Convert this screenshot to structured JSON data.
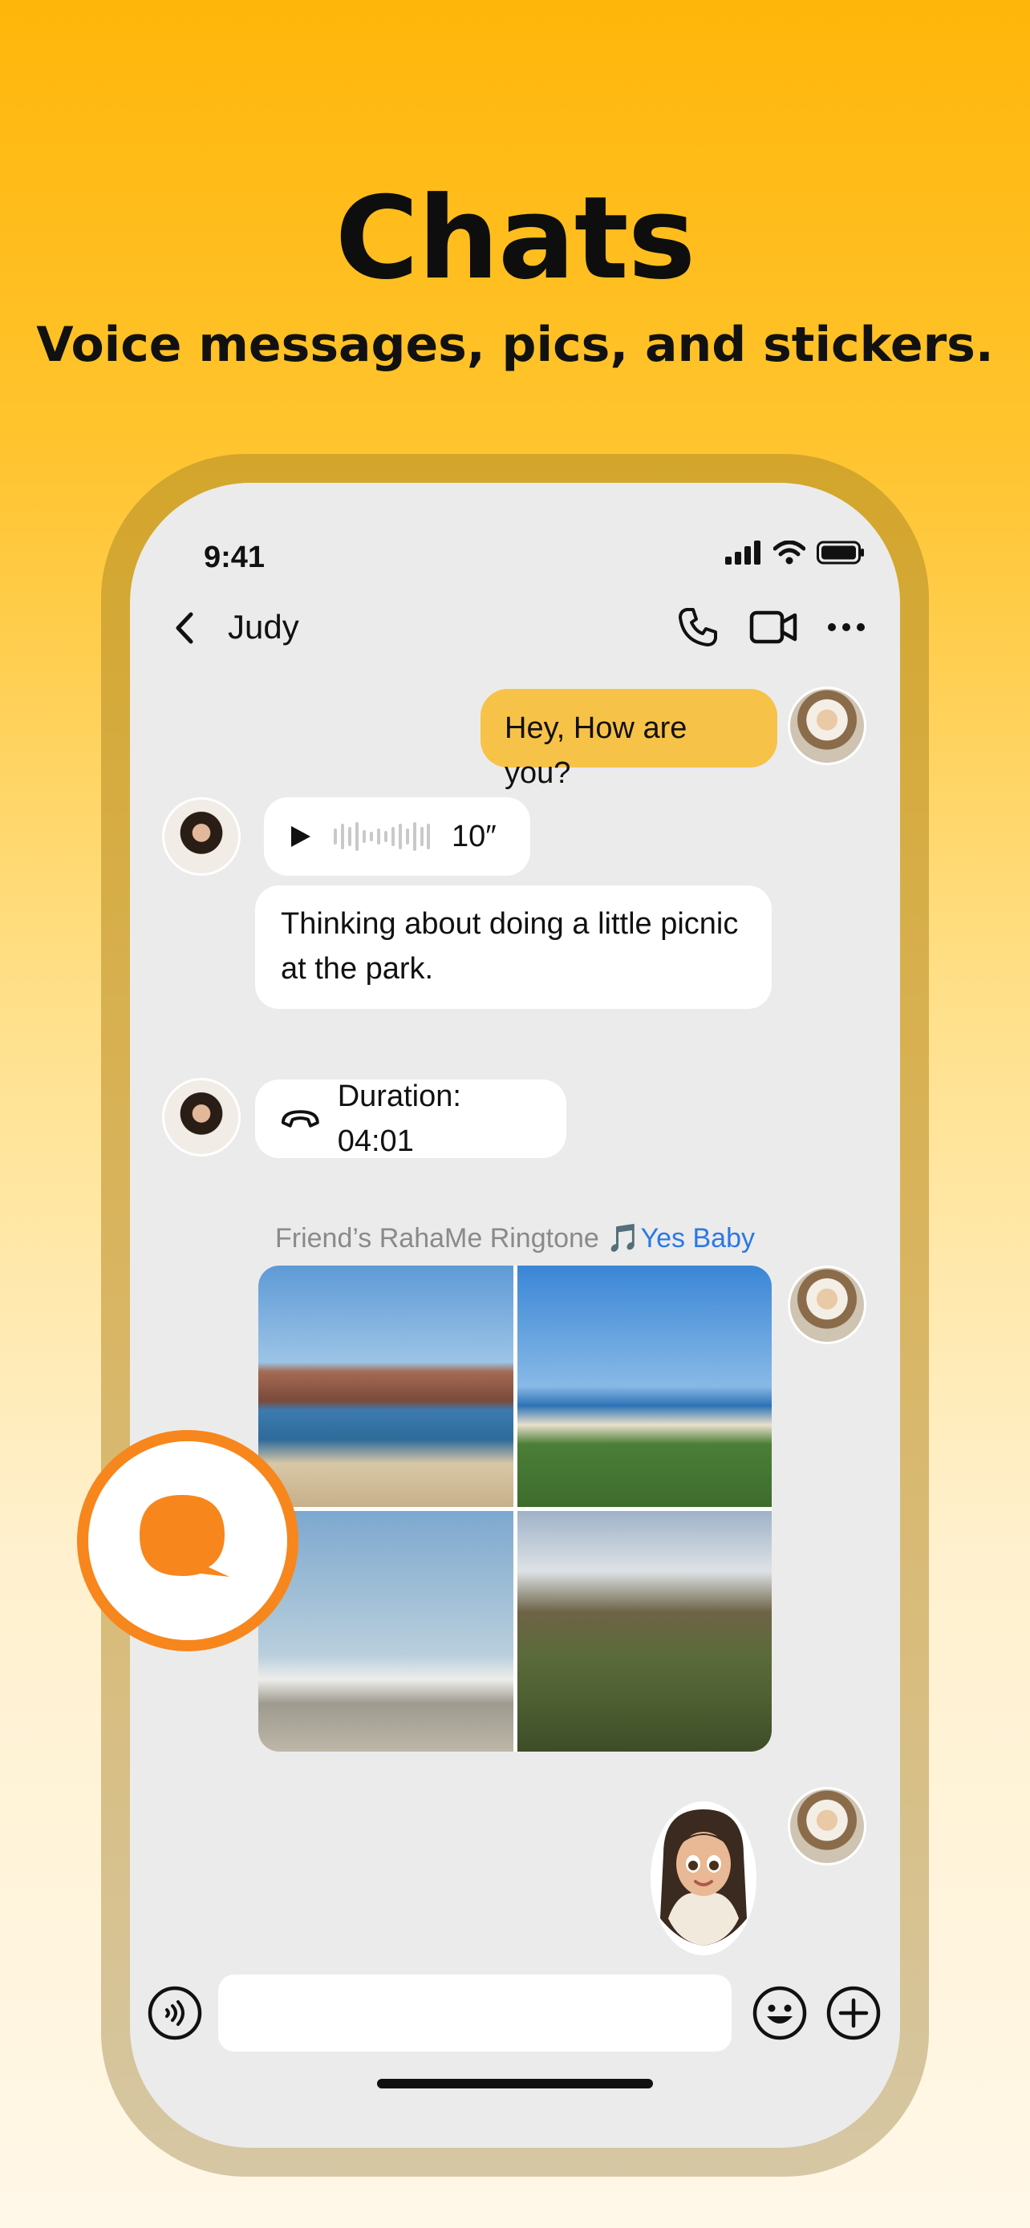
{
  "hero": {
    "title": "Chats",
    "subtitle": "Voice messages, pics, and stickers."
  },
  "status_bar": {
    "time": "9:41",
    "icons": [
      "signal-icon",
      "wifi-icon",
      "battery-icon"
    ]
  },
  "nav": {
    "back_icon": "chevron-left-icon",
    "title": "Judy",
    "icons": [
      "phone-icon",
      "video-call-icon",
      "more-icon"
    ]
  },
  "messages": [
    {
      "type": "text",
      "direction": "outgoing",
      "text": "Hey, How are you?"
    },
    {
      "type": "voice",
      "direction": "incoming",
      "duration": "10″"
    },
    {
      "type": "text",
      "direction": "incoming",
      "text_line1": "Thinking about doing a little picnic",
      "text_line2": "at the park.",
      "reaction": "👍"
    },
    {
      "type": "call",
      "direction": "incoming",
      "text": "Duration: 04:01"
    },
    {
      "type": "system",
      "text": "Friend’s RahaMe Ringtone 🎵",
      "link": "Yes Baby"
    },
    {
      "type": "photos",
      "direction": "outgoing",
      "count": 4
    },
    {
      "type": "sticker",
      "direction": "outgoing"
    }
  ],
  "composer": {
    "voice_icon": "voice-mode-icon",
    "emoji_icon": "emoji-icon",
    "add_icon": "plus-circle-icon"
  },
  "colors": {
    "accent": "#F7C248",
    "fab": "#F7861C",
    "link": "#2B78E4",
    "background_top": "#FFB60A"
  }
}
